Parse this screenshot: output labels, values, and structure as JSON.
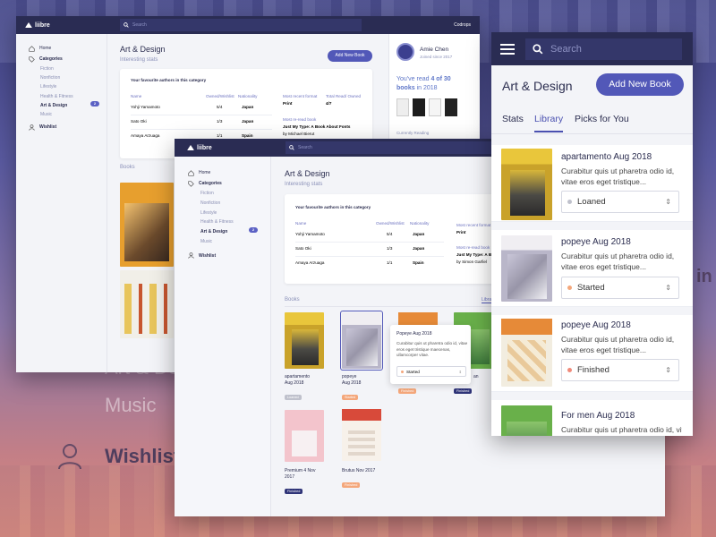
{
  "app": {
    "logo": "liibre",
    "user_corner": "Codrops"
  },
  "search": {
    "placeholder": "Search"
  },
  "nav": {
    "home": "Home",
    "categories": "Categories",
    "sub": [
      "Fiction",
      "Nonfiction",
      "Lifestyle",
      "Health & Fitness",
      "Art & Design",
      "Music"
    ],
    "active_index": 4,
    "active_badge": "2",
    "wishlist": "Wishlist"
  },
  "page": {
    "title": "Art & Design",
    "subtitle": "Interesting stats",
    "add_button": "Add New Book"
  },
  "authors": {
    "heading": "Your favourite authors in this category",
    "columns": [
      "Name",
      "Owned/Wishlist",
      "Nationality"
    ],
    "rows": [
      [
        "Yohji Yamamoto",
        "5/4",
        "Japan"
      ],
      [
        "Sato Oki",
        "1/3",
        "Japan"
      ],
      [
        "Amaya Arzuaga",
        "1/1",
        "Spain"
      ]
    ]
  },
  "stats": {
    "most_format_label": "Most recent format",
    "most_format_value": "Print",
    "total_read_label": "Total Read/ Owned",
    "total_read_value": "4/7",
    "most_read_label": "Most re-read book",
    "most_read_title": "Just My Type: A Book About Fonts",
    "most_read_author": "by Michael Bierut",
    "most_read_author_short": "by Simon Garfiel"
  },
  "profile": {
    "name": "Amie Chen",
    "joined": "Joined since 2017",
    "read_text_1": "You've read",
    "read_highlight": "4 of 30",
    "read_text_2": "books",
    "read_text_3": "in 2018",
    "currently": "Currently Reading"
  },
  "books_section": {
    "label": "Books",
    "library_tab": "Libra"
  },
  "books": [
    {
      "title": "apartamento Aug 2018",
      "line1": "apartamento",
      "line2": "Aug 2018",
      "status": "Loaned"
    },
    {
      "title": "popeye Aug 2018",
      "line1": "popeye",
      "line2": "Aug 2018",
      "status": "Started"
    },
    {
      "title": "Brutus",
      "line1": "",
      "line2": "",
      "status": "Finished"
    },
    {
      "title": "For men Aug 2018",
      "line1": "For men",
      "line2": "Aug 2018",
      "status": "Finished"
    },
    {
      "title": "Premium 4 Nov 2017",
      "line1": "Premium 4 Nov",
      "line2": "2017",
      "status": "Finished"
    },
    {
      "title": "Brutus Nov 2017",
      "line1": "Brutus Nov 2017",
      "line2": "",
      "status": "Finished"
    }
  ],
  "popover": {
    "title": "Popeye Aug 2018",
    "text": "Curabitur quis ut pharetra odio id, vitae eros eget tristique maecenas, ullamcorper vitae.",
    "status": "Started"
  },
  "mobile": {
    "search_placeholder": "Search",
    "title": "Art & Design",
    "add_button": "Add New Book",
    "tabs": [
      "Stats",
      "Library",
      "Picks for You"
    ],
    "active_tab": 1,
    "items": [
      {
        "title": "apartamento Aug 2018",
        "desc": "Curabitur quis ut pharetra odio id, vitae eros eget tristique...",
        "status": "Loaned",
        "dot": "#bfc1cc"
      },
      {
        "title": "popeye Aug 2018",
        "desc": "Curabitur quis ut pharetra odio id, vitae eros eget tristique...",
        "status": "Started",
        "dot": "#f4a77b"
      },
      {
        "title": "popeye Aug 2018",
        "desc": "Curabitur quis ut pharetra odio id, vitae eros eget tristique...",
        "status": "Finished",
        "dot": "#f08a7a"
      },
      {
        "title": "For men Aug 2018",
        "desc": "Curabitur quis ut pharetra odio id, vitae eros eget tristique...",
        "status": "",
        "dot": ""
      }
    ]
  },
  "background": {
    "art": "Art & De",
    "music": "Music",
    "wishlist": "Wishlist",
    "in": "in"
  },
  "colors": {
    "topbar": "#2a2c53",
    "accent": "#5258b8",
    "started": "#f4a77b",
    "finished": "#2f3478",
    "loaned": "#bfc1cc"
  }
}
